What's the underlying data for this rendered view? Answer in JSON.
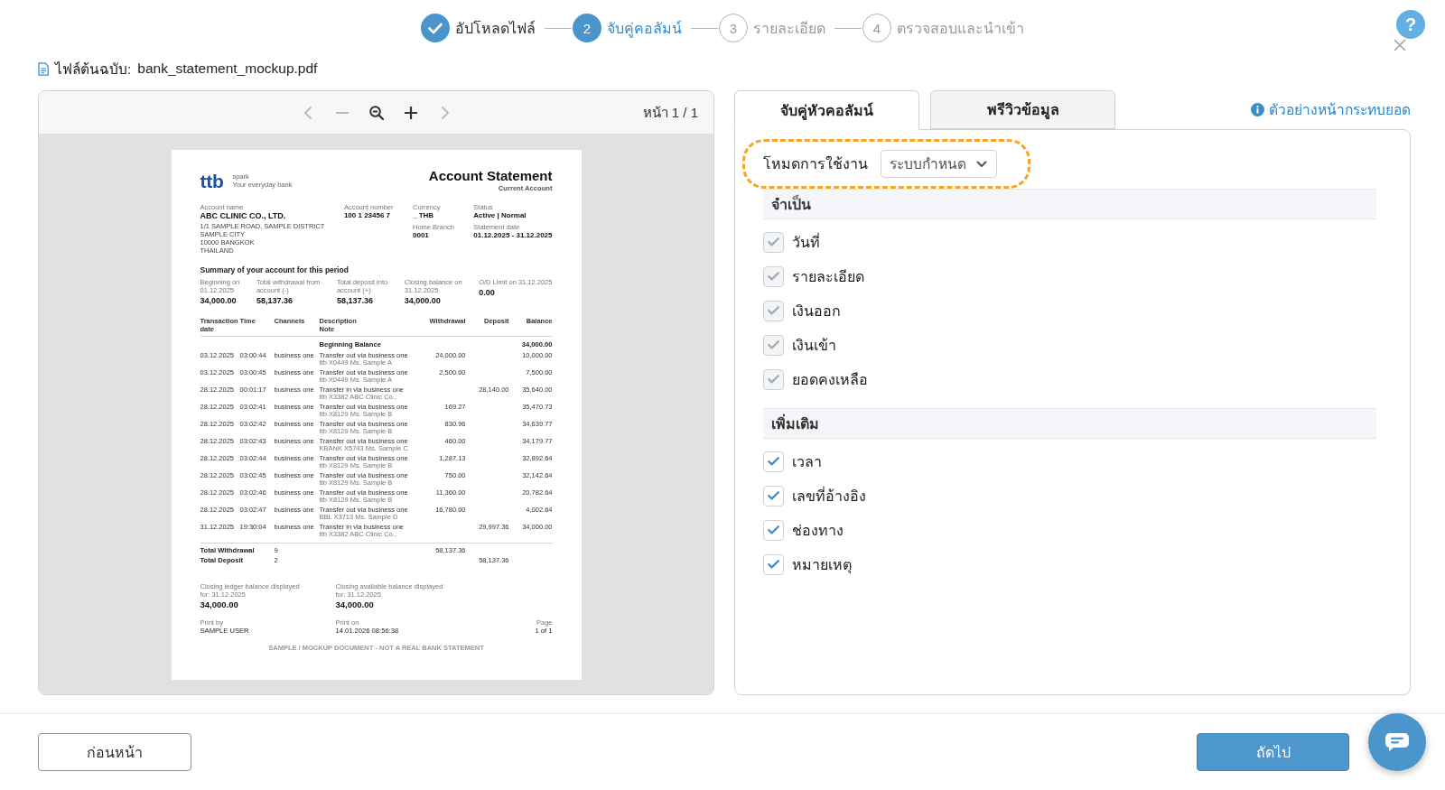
{
  "stepper": {
    "steps": [
      {
        "label": "อัปโหลดไฟล์",
        "completed": true,
        "current": false
      },
      {
        "number": "2",
        "label": "จับคู่คอลัมน์",
        "completed": false,
        "current": true
      },
      {
        "number": "3",
        "label": "รายละเอียด",
        "completed": false,
        "current": false
      },
      {
        "number": "4",
        "label": "ตรวจสอบและนำเข้า",
        "completed": false,
        "current": false
      }
    ]
  },
  "help_button": {
    "label": "?"
  },
  "source_file": {
    "label": "ไฟล์ต้นฉบับ:",
    "name": "bank_statement_mockup.pdf"
  },
  "viewer": {
    "toolbar": {
      "tools": [
        {
          "kind": "previous",
          "disabled": true
        },
        {
          "kind": "minus",
          "disabled": true
        },
        {
          "kind": "zoom_out",
          "disabled": false
        },
        {
          "kind": "plus",
          "disabled": false
        },
        {
          "kind": "next",
          "disabled": true
        }
      ],
      "page_indicator": "หน้า 1 / 1"
    },
    "document": {
      "logo": "ttb",
      "brand_name": "spark",
      "tagline": "Your everyday bank",
      "title": "Account Statement",
      "subtitle": "Current Account",
      "account_info": [
        {
          "fields": [
            {
              "label": "Account name",
              "value": "ABC CLINIC CO., LTD.",
              "address": [
                "1/1 SAMPLE ROAD, SAMPLE DISTRICT",
                "SAMPLE CITY",
                "10000 BANGKOK",
                "THAILAND"
              ]
            }
          ]
        },
        {
          "fields": [
            {
              "label": "Account number",
              "value": "100 1 23456 7"
            }
          ]
        },
        {
          "fields": [
            {
              "label": "Currency",
              "value": "_ THB"
            },
            {
              "label": "Home Branch",
              "value": "0001"
            }
          ]
        },
        {
          "fields": [
            {
              "label": "Status",
              "value": "Active | Normal"
            },
            {
              "label": "Statement date",
              "value": "01.12.2025 - 31.12.2025"
            }
          ]
        }
      ],
      "summary": {
        "title": "Summary of your account for this period",
        "items": [
          {
            "label": "Beginning on\n01.12.2025",
            "value": "34,000.00"
          },
          {
            "label": "Total withdrawal from\naccount (-)",
            "value": "58,137.36"
          },
          {
            "label": "Total deposit into\naccount (+)",
            "value": "58,137.36"
          },
          {
            "label": "Closing balance on\n31.12.2025",
            "value": "34,000.00"
          },
          {
            "label": "O/D Limit on 31.12.2025",
            "value": "0.00"
          }
        ]
      },
      "transactions": {
        "columns": [
          "Transaction\ndate",
          "Time",
          "Channels",
          "Description\nNote",
          "Withdrawal",
          "Deposit",
          "Balance"
        ],
        "opening": {
          "description": "Beginning Balance",
          "balance": "34,000.00"
        },
        "rows": [
          {
            "date": "03.12.2025",
            "time": "03:00:44",
            "channel": "business one",
            "description": "Transfer out via business one",
            "note": "ttb X0449 Ms. Sample A",
            "withdrawal": "24,000.00",
            "balance": "10,000.00"
          },
          {
            "date": "03.12.2025",
            "time": "03:00:45",
            "channel": "business one",
            "description": "Transfer out via business one",
            "note": "ttb X0449 Ms. Sample A",
            "withdrawal": "2,500.00",
            "balance": "7,500.00"
          },
          {
            "date": "28.12.2025",
            "time": "00:01:17",
            "channel": "business one",
            "description": "Transfer in via business one",
            "note": "ttb X3382 ABC Clinic Co.,",
            "deposit": "28,140.00",
            "balance": "35,640.00"
          },
          {
            "date": "28.12.2025",
            "time": "03:02:41",
            "channel": "business one",
            "description": "Transfer out via business one",
            "note": "ttb X8129 Ms. Sample B",
            "withdrawal": "169.27",
            "balance": "35,470.73"
          },
          {
            "date": "28.12.2025",
            "time": "03:02:42",
            "channel": "business one",
            "description": "Transfer out via business one",
            "note": "ttb X8129 Ms. Sample B",
            "withdrawal": "830.96",
            "balance": "34,639.77"
          },
          {
            "date": "28.12.2025",
            "time": "03:02:43",
            "channel": "business one",
            "description": "Transfer out via business one",
            "note": "KBANK X5743 Ms. Sample C",
            "withdrawal": "460.00",
            "balance": "34,179.77"
          },
          {
            "date": "28.12.2025",
            "time": "03:02:44",
            "channel": "business one",
            "description": "Transfer out via business one",
            "note": "ttb X8129 Ms. Sample B",
            "withdrawal": "1,287.13",
            "balance": "32,892.64"
          },
          {
            "date": "28.12.2025",
            "time": "03:02:45",
            "channel": "business one",
            "description": "Transfer out via business one",
            "note": "ttb X8129 Ms. Sample B",
            "withdrawal": "750.00",
            "balance": "32,142.64"
          },
          {
            "date": "28.12.2025",
            "time": "03:02:46",
            "channel": "business one",
            "description": "Transfer out via business one",
            "note": "ttb X8129 Ms. Sample B",
            "withdrawal": "11,360.00",
            "balance": "20,782.64"
          },
          {
            "date": "28.12.2025",
            "time": "03:02:47",
            "channel": "business one",
            "description": "Transfer out via business one",
            "note": "BBL X3713 Ms. Sample D",
            "withdrawal": "16,780.00",
            "balance": "4,002.64"
          },
          {
            "date": "31.12.2025",
            "time": "19:30:04",
            "channel": "business one",
            "description": "Transfer in via business one",
            "note": "ttb X3382 ABC Clinic Co.,",
            "deposit": "29,997.36",
            "balance": "34,000.00"
          }
        ],
        "totals": [
          {
            "label": "Total Withdrawal",
            "count": "9",
            "withdrawal": "58,137.36"
          },
          {
            "label": "Total Deposit",
            "count": "2",
            "deposit": "58,137.36"
          }
        ]
      },
      "closing_balances": [
        {
          "label": "Closing ledger balance displayed\nfor: 31.12.2025",
          "value": "34,000.00"
        },
        {
          "label": "Closing available balance displayed\nfor: 31.12.2025",
          "value": "34,000.00"
        }
      ],
      "print_info": [
        {
          "label": "Print by",
          "value": "SAMPLE USER"
        },
        {
          "label": "Print on",
          "value": "14.01.2026 08:56:38"
        },
        {
          "label": "Page",
          "value": "1 of 1"
        }
      ],
      "footer_note": "SAMPLE / MOCKUP DOCUMENT - NOT A REAL BANK STATEMENT"
    }
  },
  "mapping": {
    "tabs": [
      {
        "label": "จับคู่หัวคอลัมน์",
        "selected": true
      },
      {
        "label": "พรีวิวข้อมูล",
        "selected": false
      }
    ],
    "example_link": "ตัวอย่างหน้ากระทบยอด",
    "mode": {
      "label": "โหมดการใช้งาน",
      "value": "ระบบกำหนด",
      "highlighted": true
    },
    "groups": [
      {
        "title": "จำเป็น",
        "columns": [
          {
            "label": "วันที่",
            "checked": true,
            "disabled": true
          },
          {
            "label": "รายละเอียด",
            "checked": true,
            "disabled": true
          },
          {
            "label": "เงินออก",
            "checked": true,
            "disabled": true
          },
          {
            "label": "เงินเข้า",
            "checked": true,
            "disabled": true
          },
          {
            "label": "ยอดคงเหลือ",
            "checked": true,
            "disabled": true
          }
        ]
      },
      {
        "title": "เพิ่มเติม",
        "columns": [
          {
            "label": "เวลา",
            "checked": true,
            "disabled": false
          },
          {
            "label": "เลขที่อ้างอิง",
            "checked": true,
            "disabled": false
          },
          {
            "label": "ช่องทาง",
            "checked": true,
            "disabled": false
          },
          {
            "label": "หมายเหตุ",
            "checked": true,
            "disabled": false
          }
        ]
      }
    ]
  },
  "footer": {
    "back_button": "ก่อนหน้า",
    "next_button": "ถัดไป"
  }
}
